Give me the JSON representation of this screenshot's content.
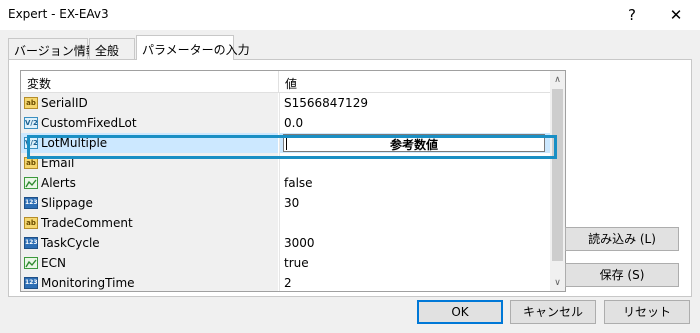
{
  "window": {
    "title": "Expert - EX-EAv3",
    "help_glyph": "?",
    "close_glyph": "✕"
  },
  "tabs": [
    {
      "label": "バージョン情報",
      "active": false
    },
    {
      "label": "全般",
      "active": false
    },
    {
      "label": "パラメーターの入力",
      "active": true
    }
  ],
  "grid": {
    "headers": {
      "name": "変数",
      "value": "値"
    },
    "rows": [
      {
        "icon": "ab-string-icon",
        "icon_text": "ab",
        "name": "SerialID",
        "value": "S1566847129"
      },
      {
        "icon": "va-double-icon",
        "icon_text": "V/2",
        "name": "CustomFixedLot",
        "value": "0.0"
      },
      {
        "icon": "va-double-icon",
        "icon_text": "V/2",
        "name": "LotMultiple",
        "value": "",
        "editing": true,
        "edit_text": "参考数値"
      },
      {
        "icon": "ab-string-icon",
        "icon_text": "ab",
        "name": "Email",
        "value": ""
      },
      {
        "icon": "bool-icon",
        "icon_text": "",
        "name": "Alerts",
        "value": "false"
      },
      {
        "icon": "int-123-icon",
        "icon_text": "123",
        "name": "Slippage",
        "value": "30"
      },
      {
        "icon": "ab-string-icon",
        "icon_text": "ab",
        "name": "TradeComment",
        "value": ""
      },
      {
        "icon": "int-123-icon",
        "icon_text": "123",
        "name": "TaskCycle",
        "value": "3000"
      },
      {
        "icon": "bool-icon",
        "icon_text": "",
        "name": "ECN",
        "value": "true"
      },
      {
        "icon": "int-123-icon",
        "icon_text": "123",
        "name": "MonitoringTime",
        "value": "2"
      }
    ],
    "selected_row": "LotMultiple",
    "highlight_color": "#1a8fc4"
  },
  "scrollbar": {
    "up_glyph": "∧",
    "down_glyph": "∨"
  },
  "side_buttons": {
    "load": "読み込み (L)",
    "save": "保存 (S)"
  },
  "footer": {
    "ok": "OK",
    "cancel": "キャンセル",
    "reset": "リセット"
  }
}
